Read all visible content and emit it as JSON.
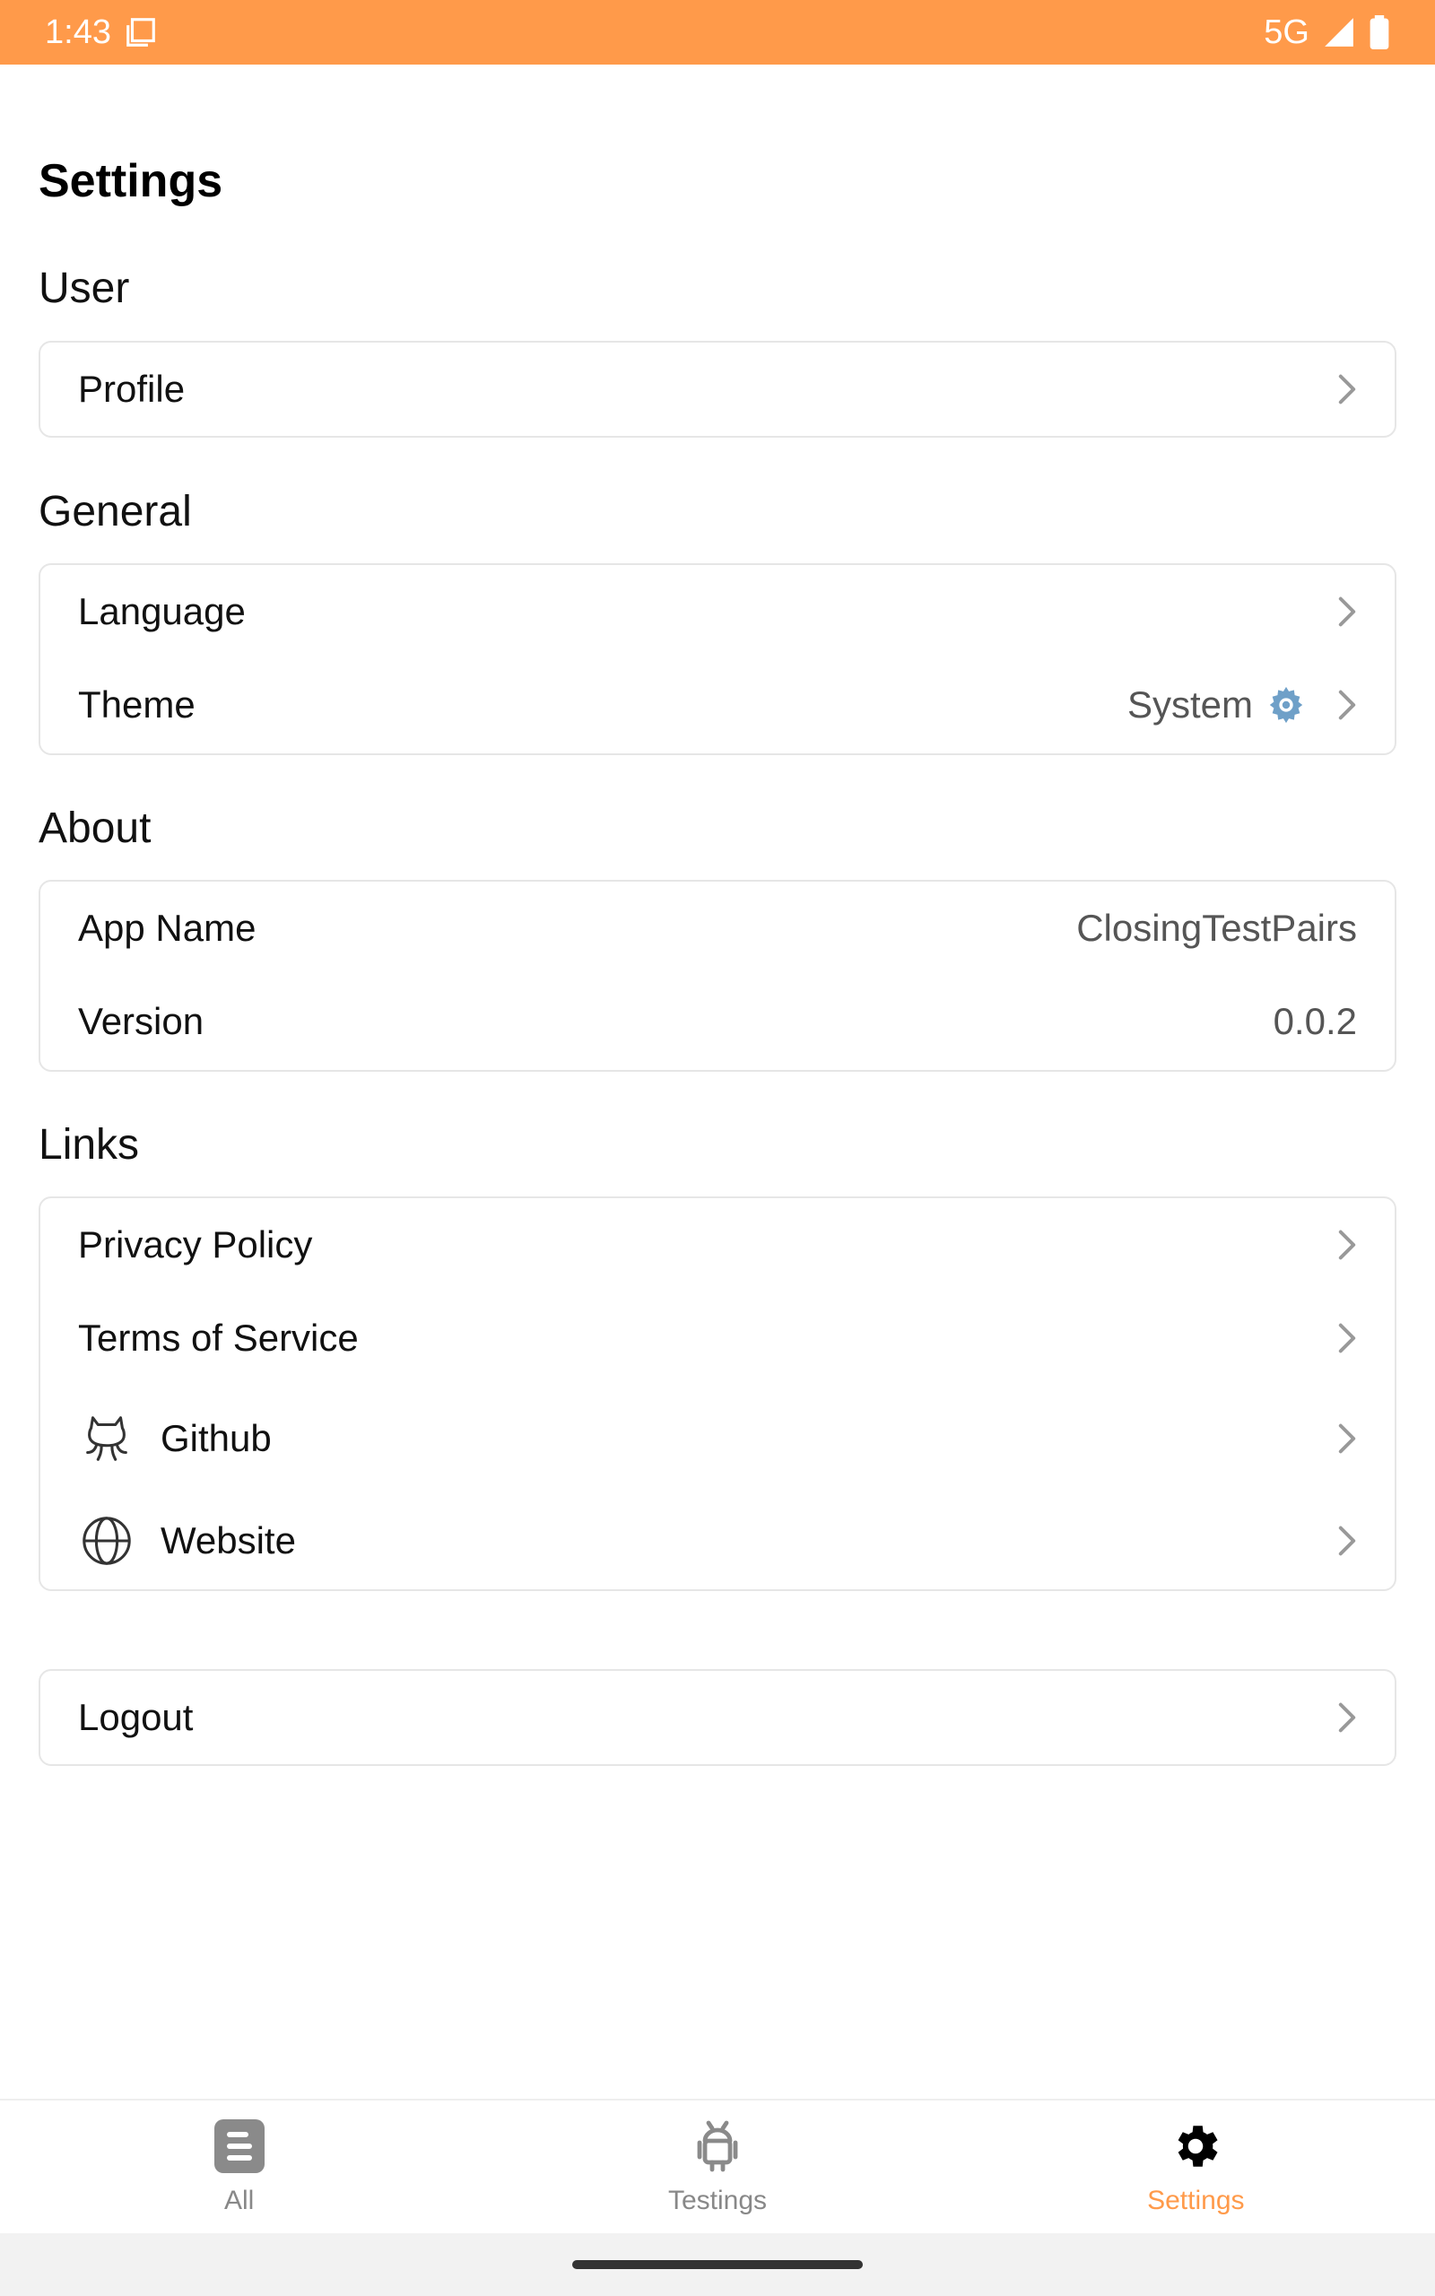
{
  "status_bar": {
    "time": "1:43",
    "network": "5G"
  },
  "header": {
    "title": "Settings"
  },
  "sections": {
    "user": {
      "label": "User",
      "items": [
        {
          "label": "Profile"
        }
      ]
    },
    "general": {
      "label": "General",
      "items": [
        {
          "label": "Language"
        },
        {
          "label": "Theme",
          "value": "System"
        }
      ]
    },
    "about": {
      "label": "About",
      "items": [
        {
          "label": "App Name",
          "value": "ClosingTestPairs"
        },
        {
          "label": "Version",
          "value": "0.0.2"
        }
      ]
    },
    "links": {
      "label": "Links",
      "items": [
        {
          "label": "Privacy Policy"
        },
        {
          "label": "Terms of Service"
        },
        {
          "label": "Github",
          "icon": "github-icon"
        },
        {
          "label": "Website",
          "icon": "globe-icon"
        }
      ]
    }
  },
  "logout": {
    "label": "Logout"
  },
  "bottom_nav": {
    "items": [
      {
        "label": "All",
        "icon": "document-icon",
        "active": false
      },
      {
        "label": "Testings",
        "icon": "android-icon",
        "active": false
      },
      {
        "label": "Settings",
        "icon": "gear-icon",
        "active": true
      }
    ]
  },
  "colors": {
    "accent": "#FF9A4A",
    "border": "#E6E6E6",
    "muted_text": "#555555",
    "inactive_nav": "#888888"
  }
}
